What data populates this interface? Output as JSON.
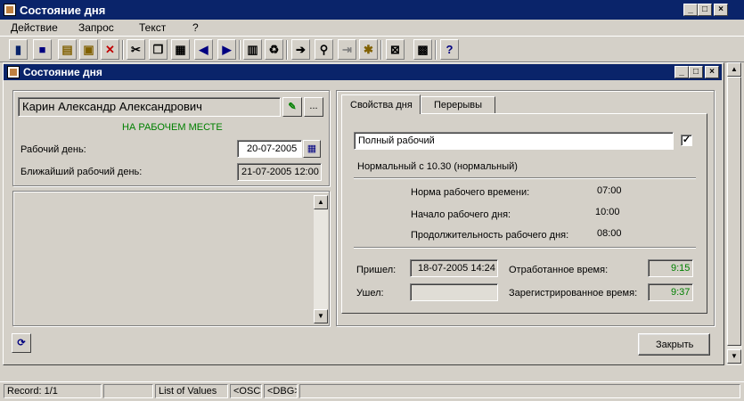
{
  "window": {
    "title": "Состояние дня"
  },
  "menu": {
    "items": [
      "Действие",
      "Запрос",
      "Текст",
      "?"
    ]
  },
  "child": {
    "title": "Состояние дня"
  },
  "employee": {
    "name": "Карин Александр Александрович",
    "status": "НА РАБОЧЕМ МЕСТЕ",
    "more_label": "...",
    "workday_label": "Рабочий день:",
    "workday_value": "20-07-2005",
    "nearest_label": "Ближайший рабочий день:",
    "nearest_value": "21-07-2005 12:00"
  },
  "tabs": {
    "active": "Свойства дня",
    "other": "Перерывы"
  },
  "day": {
    "type": "Полный рабочий",
    "schedule": "Нормальный с 10.30 (нормальный)",
    "norm_label": "Норма рабочего времени:",
    "norm_value": "07:00",
    "start_label": "Начало рабочего дня:",
    "start_value": "10:00",
    "duration_label": "Продолжительность рабочего дня:",
    "duration_value": "08:00",
    "arrived_label": "Пришел:",
    "arrived_value": "18-07-2005 14:24",
    "left_label": "Ушел:",
    "left_value": "",
    "worked_label": "Отработанное время:",
    "worked_value": "9:15",
    "registered_label": "Зарегистрированное время:",
    "registered_value": "9:37"
  },
  "buttons": {
    "close": "Закрыть"
  },
  "statusbar": {
    "record": "Record: 1/1",
    "empty": "",
    "lov": "List of Values",
    "osc": "<OSC>",
    "dbg": "<DBG>"
  },
  "colors": {
    "title_bg": "#0a246a",
    "status_green": "#008000",
    "face": "#d4d0c8"
  }
}
